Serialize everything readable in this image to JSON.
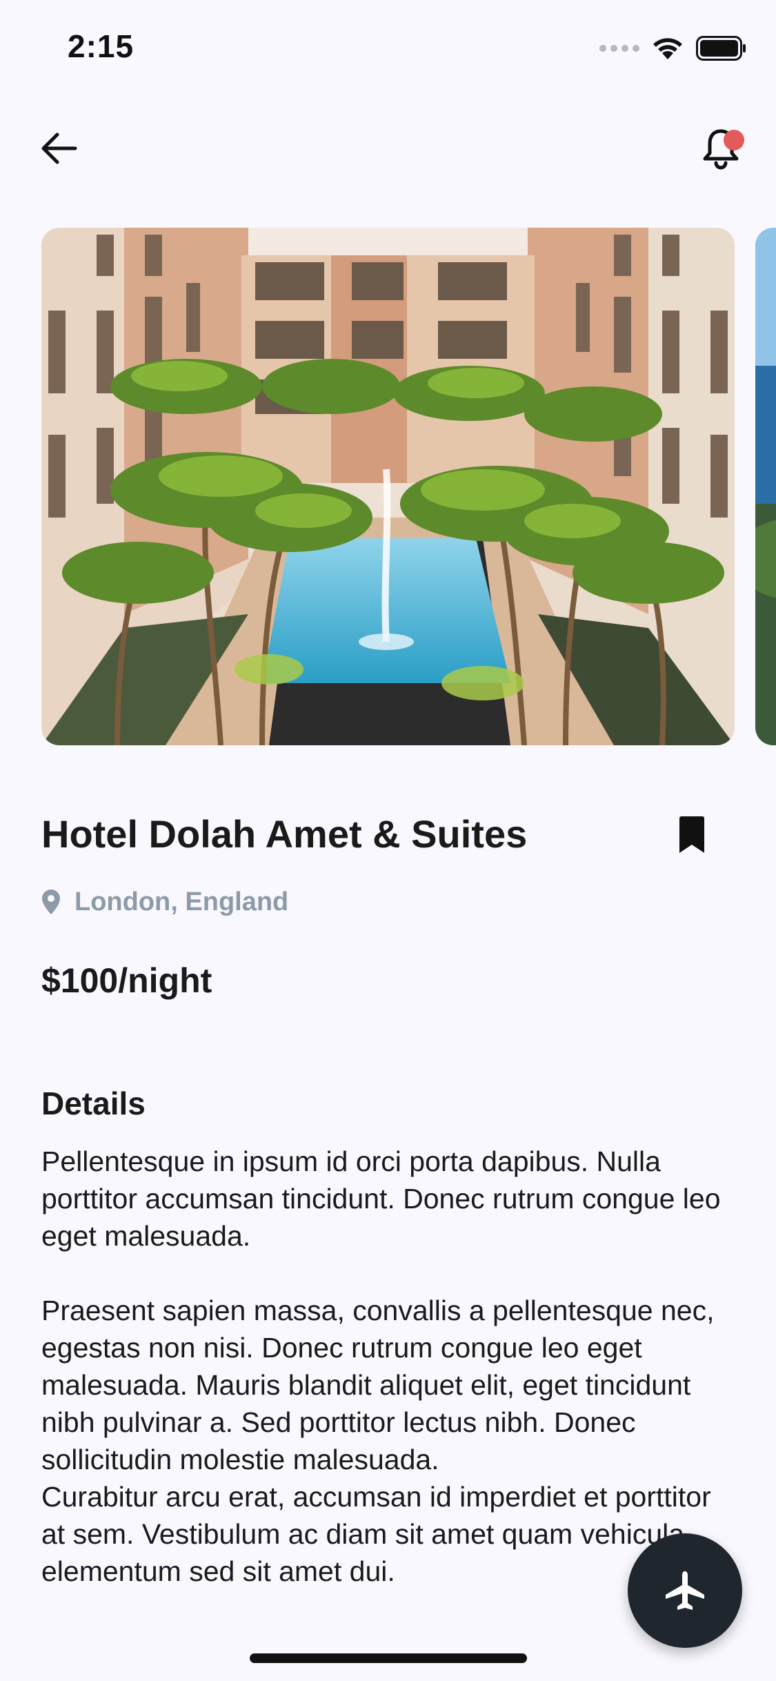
{
  "status_bar": {
    "time": "2:15"
  },
  "hotel": {
    "title": "Hotel Dolah Amet & Suites",
    "location": "London, England",
    "price": "$100/night"
  },
  "details": {
    "heading": "Details",
    "paragraphs": [
      "Pellentesque in ipsum id orci porta dapibus. Nulla porttitor accumsan tincidunt. Donec rutrum congue leo eget malesuada.",
      "Praesent sapien massa, convallis a pellentesque nec, egestas non nisi. Donec rutrum congue leo eget malesuada. Mauris blandit aliquet elit, eget tincidunt nibh pulvinar a. Sed porttitor lectus nibh. Donec sollicitudin molestie malesuada.",
      "Curabitur arcu erat, accumsan id imperdiet et porttitor at sem. Vestibulum ac diam sit amet quam vehicula elementum sed sit amet dui."
    ]
  },
  "icons": {
    "back": "arrow-left-icon",
    "notifications": "bell-icon",
    "bookmark": "bookmark-icon",
    "location": "map-pin-icon",
    "fab": "airplane-icon"
  },
  "colors": {
    "background": "#f9f8fe",
    "text": "#1a1a1a",
    "muted": "#8d9aa8",
    "notification_dot": "#e25a5a",
    "fab": "#1f262e"
  }
}
